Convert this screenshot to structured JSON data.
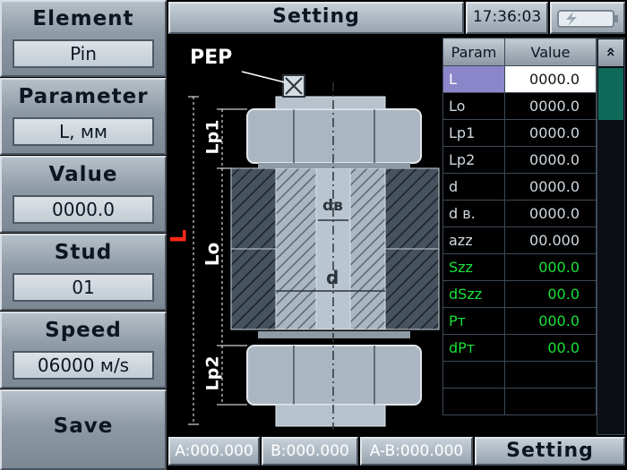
{
  "left_panel": [
    {
      "label": "Element",
      "value": "Pin"
    },
    {
      "label": "Parameter",
      "value": "L, мм"
    },
    {
      "label": "Value",
      "value": "0000.0"
    },
    {
      "label": "Stud",
      "value": "01"
    },
    {
      "label": "Speed",
      "value": "06000 м/s"
    }
  ],
  "save_label": "Save",
  "header": {
    "title": "Setting",
    "time": "17:36:03"
  },
  "diagram": {
    "pep": "PEP",
    "L": "L",
    "lp1": "Lp1",
    "lo": "Lo",
    "lp2": "Lp2",
    "dv": "dв",
    "d": "d"
  },
  "table": {
    "headers": [
      "Param",
      "Value"
    ],
    "rows": [
      {
        "param": "L",
        "value": "0000.0"
      },
      {
        "param": "Lo",
        "value": "0000.0"
      },
      {
        "param": "Lp1",
        "value": "0000.0"
      },
      {
        "param": "Lp2",
        "value": "0000.0"
      },
      {
        "param": "d",
        "value": "0000.0"
      },
      {
        "param": "d в.",
        "value": "0000.0"
      },
      {
        "param": "azz",
        "value": "00.000"
      },
      {
        "param": "Szz",
        "value": "000.0"
      },
      {
        "param": "dSzz",
        "value": "00.0"
      },
      {
        "param": "Pт",
        "value": "000.0"
      },
      {
        "param": "dPт",
        "value": "00.0"
      },
      {
        "param": "",
        "value": ""
      },
      {
        "param": "",
        "value": ""
      }
    ],
    "scroll_up": "»"
  },
  "footer": {
    "a": "A:000.000",
    "b": "B:000.000",
    "ab": "A-B:000.000",
    "mode": "Setting"
  },
  "colors": {
    "selected_row": "#8b86c9",
    "green_text": "#19e03a",
    "red_label": "#ff2a1a"
  }
}
